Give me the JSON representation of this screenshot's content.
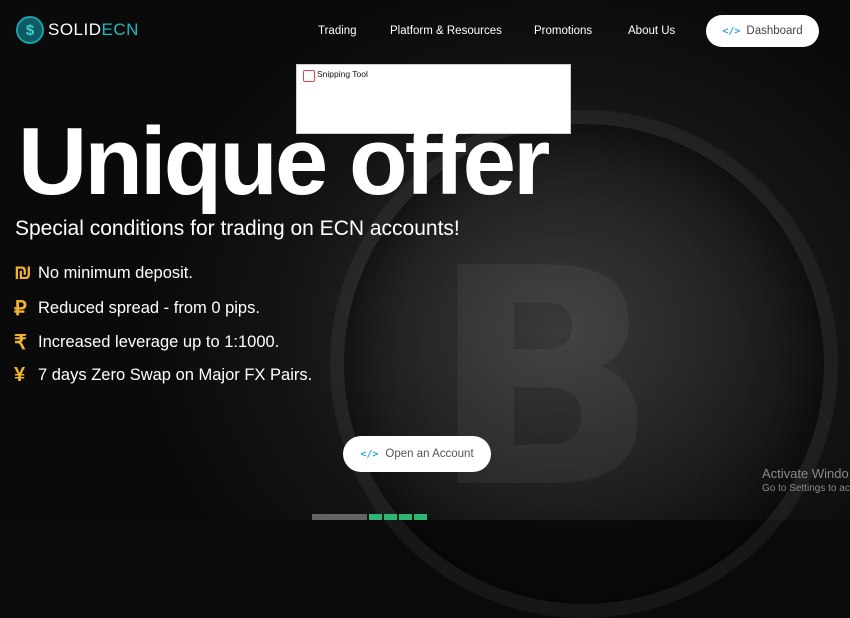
{
  "header": {
    "logo_icon": "dollar-coin-icon",
    "logo_text_a": "SOLID",
    "logo_text_b": "ECN",
    "nav": [
      "Trading",
      "Platform & Resources",
      "Promotions",
      "About Us"
    ],
    "dashboard_label": "Dashboard",
    "dashboard_icon": "code-icon"
  },
  "snipping_tool": {
    "title": "Snipping Tool",
    "icon": "snipping-tool-icon"
  },
  "hero": {
    "title": "Unique offer",
    "subtitle": "Special conditions for trading on ECN accounts!",
    "features": [
      {
        "symbol": "₪",
        "text": "No minimum deposit."
      },
      {
        "symbol": "₽",
        "text": "Reduced spread - from 0 pips."
      },
      {
        "symbol": "₹",
        "text": "Increased leverage up to 1:1000."
      },
      {
        "symbol": "¥",
        "text": "7 days Zero Swap on Major FX Pairs."
      }
    ],
    "cta_label": "Open an Account",
    "cta_icon": "code-icon"
  },
  "watermark": {
    "line1": "Activate Windo",
    "line2": "Go to Settings to ac"
  },
  "colors": {
    "brand": "#1fb9c4",
    "accent_gold": "#f0b431",
    "button_bg": "#ffffff",
    "icon_blue": "#2aa6d9"
  }
}
